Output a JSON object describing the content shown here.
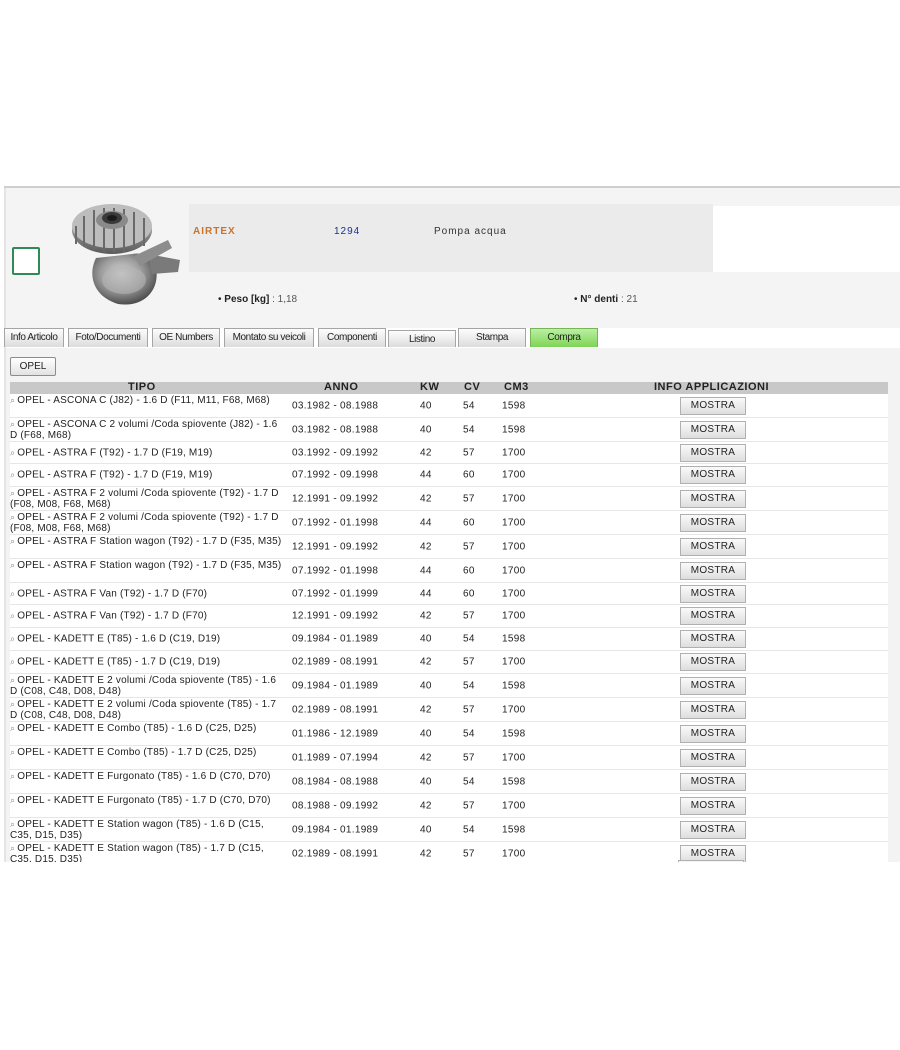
{
  "product": {
    "brand": "AIRTEX",
    "code": "1294",
    "description": "Pompa acqua",
    "specs": [
      {
        "label": "Peso [kg]",
        "value": "1,18"
      },
      {
        "label": "N° denti",
        "value": "21"
      }
    ],
    "image_icon": "water-pump-image"
  },
  "tabs": [
    {
      "label": "Info Articolo",
      "active": false
    },
    {
      "label": "Foto/Documenti",
      "active": false
    },
    {
      "label": "OE Numbers",
      "active": false
    },
    {
      "label": "Montato su veicoli",
      "active": false
    },
    {
      "label": "Componenti",
      "active": false
    },
    {
      "label": "Listino",
      "active": false
    },
    {
      "label": "Stampa",
      "active": false
    },
    {
      "label": "Compra",
      "active": true
    }
  ],
  "filter_button": "OPEL",
  "table": {
    "headers": {
      "tipo": "TIPO",
      "anno": "ANNO",
      "kw": "KW",
      "cv": "CV",
      "cm3": "CM3",
      "info": "INFO APPLICAZIONI"
    },
    "button_label": "MOSTRA",
    "rows": [
      {
        "tipo": "OPEL - ASCONA C (J82) - 1.6 D (F11, M11, F68, M68)",
        "anno": "03.1982 - 08.1988",
        "kw": "40",
        "cv": "54",
        "cm3": "1598"
      },
      {
        "tipo": "OPEL - ASCONA C 2 volumi /Coda spiovente (J82) - 1.6 D (F68, M68)",
        "anno": "03.1982 - 08.1988",
        "kw": "40",
        "cv": "54",
        "cm3": "1598"
      },
      {
        "tipo": "OPEL - ASTRA F (T92) - 1.7 D (F19, M19)",
        "anno": "03.1992 - 09.1992",
        "kw": "42",
        "cv": "57",
        "cm3": "1700"
      },
      {
        "tipo": "OPEL - ASTRA F (T92) - 1.7 D (F19, M19)",
        "anno": "07.1992 - 09.1998",
        "kw": "44",
        "cv": "60",
        "cm3": "1700"
      },
      {
        "tipo": "OPEL - ASTRA F 2 volumi /Coda spiovente (T92) - 1.7 D (F08, M08, F68, M68)",
        "anno": "12.1991 - 09.1992",
        "kw": "42",
        "cv": "57",
        "cm3": "1700"
      },
      {
        "tipo": "OPEL - ASTRA F 2 volumi /Coda spiovente (T92) - 1.7 D (F08, M08, F68, M68)",
        "anno": "07.1992 - 01.1998",
        "kw": "44",
        "cv": "60",
        "cm3": "1700"
      },
      {
        "tipo": "OPEL - ASTRA F Station wagon (T92) - 1.7 D (F35, M35)",
        "anno": "12.1991 - 09.1992",
        "kw": "42",
        "cv": "57",
        "cm3": "1700"
      },
      {
        "tipo": "OPEL - ASTRA F Station wagon (T92) - 1.7 D (F35, M35)",
        "anno": "07.1992 - 01.1998",
        "kw": "44",
        "cv": "60",
        "cm3": "1700"
      },
      {
        "tipo": "OPEL - ASTRA F Van (T92) - 1.7 D (F70)",
        "anno": "07.1992 - 01.1999",
        "kw": "44",
        "cv": "60",
        "cm3": "1700"
      },
      {
        "tipo": "OPEL - ASTRA F Van (T92) - 1.7 D (F70)",
        "anno": "12.1991 - 09.1992",
        "kw": "42",
        "cv": "57",
        "cm3": "1700"
      },
      {
        "tipo": "OPEL - KADETT E (T85) - 1.6 D (C19, D19)",
        "anno": "09.1984 - 01.1989",
        "kw": "40",
        "cv": "54",
        "cm3": "1598"
      },
      {
        "tipo": "OPEL - KADETT E (T85) - 1.7 D (C19, D19)",
        "anno": "02.1989 - 08.1991",
        "kw": "42",
        "cv": "57",
        "cm3": "1700"
      },
      {
        "tipo": "OPEL - KADETT E 2 volumi /Coda spiovente (T85) - 1.6 D (C08, C48, D08, D48)",
        "anno": "09.1984 - 01.1989",
        "kw": "40",
        "cv": "54",
        "cm3": "1598"
      },
      {
        "tipo": "OPEL - KADETT E 2 volumi /Coda spiovente (T85) - 1.7 D (C08, C48, D08, D48)",
        "anno": "02.1989 - 08.1991",
        "kw": "42",
        "cv": "57",
        "cm3": "1700"
      },
      {
        "tipo": "OPEL - KADETT E Combo (T85) - 1.6 D (C25, D25)",
        "anno": "01.1986 - 12.1989",
        "kw": "40",
        "cv": "54",
        "cm3": "1598"
      },
      {
        "tipo": "OPEL - KADETT E Combo (T85) - 1.7 D (C25, D25)",
        "anno": "01.1989 - 07.1994",
        "kw": "42",
        "cv": "57",
        "cm3": "1700"
      },
      {
        "tipo": "OPEL - KADETT E Furgonato (T85) - 1.6 D (C70, D70)",
        "anno": "08.1984 - 08.1988",
        "kw": "40",
        "cv": "54",
        "cm3": "1598"
      },
      {
        "tipo": "OPEL - KADETT E Furgonato (T85) - 1.7 D (C70, D70)",
        "anno": "08.1988 - 09.1992",
        "kw": "42",
        "cv": "57",
        "cm3": "1700"
      },
      {
        "tipo": "OPEL - KADETT E Station wagon (T85) - 1.6 D (C15, C35, D15, D35)",
        "anno": "09.1984 - 01.1989",
        "kw": "40",
        "cv": "54",
        "cm3": "1598"
      },
      {
        "tipo": "OPEL - KADETT E Station wagon (T85) - 1.7 D (C15, C35, D15, D35)",
        "anno": "02.1989 - 08.1991",
        "kw": "42",
        "cv": "57",
        "cm3": "1700"
      }
    ]
  },
  "colors": {
    "brand": "#c8742c",
    "code": "#1c2f8c",
    "active_tab": "#8fdc66",
    "checkbox_border": "#2f8a57"
  },
  "icons": {
    "row_icon": "magnifier-icon"
  }
}
